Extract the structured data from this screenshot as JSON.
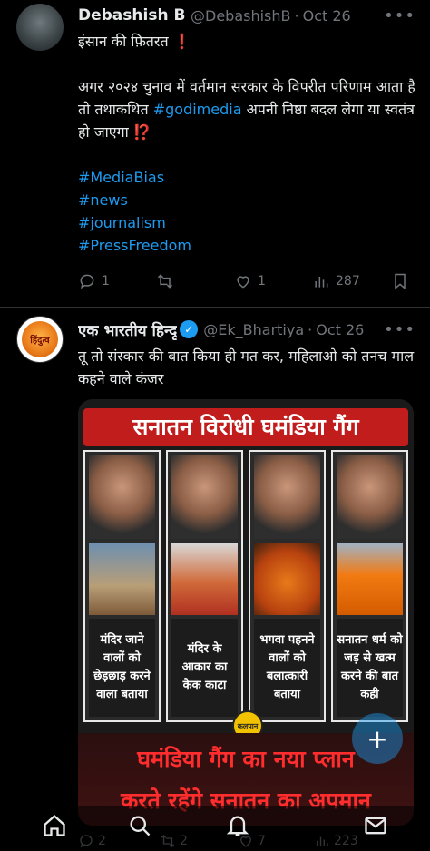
{
  "tweets": [
    {
      "name": "Debashish Bı",
      "handle": "@DebashishB",
      "time": "Oct 26",
      "line1": "इंसान की फ़ितरत",
      "line1_emoji": "❗",
      "para": "अगर २०२४ चुनाव में वर्तमान सरकार के विपरीत परिणाम आता है तो तथाकथित ",
      "para_link": "#godimedia",
      "para_end": " अपनी निष्ठा बदल लेगा या स्वतंत्र हो जाएगा ",
      "para_emoji": "⁉️",
      "hashtags": [
        "#MediaBias",
        "#news",
        "#journalism",
        "#PressFreedom"
      ],
      "replies": "1",
      "retweets": "",
      "likes": "1",
      "views": "287"
    },
    {
      "name": "एक भारतीय हिन्दू",
      "handle": "@Ek_Bhartiya",
      "time": "Oct 26",
      "text": "तू तो संस्कार की बात किया ही मत कर, महिलाओ को तनच माल कहने वाले कंजर",
      "logo_text": "हिंदुत्व",
      "replies": "2",
      "retweets": "2",
      "likes": "7",
      "views": "223"
    }
  ],
  "poster": {
    "title": "सनातन विरोधी घमंडिया गैंग",
    "captions": [
      "मंदिर जाने वालों को छेड़छाड़ करने वाला बताया",
      "मंदिर के आकार का केक काटा",
      "भगवा पहनने वालों को बलात्कारी बताया",
      "सनातन धर्म को जड़ से खत्म करने की बात कही"
    ],
    "badge": "कलपान",
    "banner_line1": "घमंडिया गैंग का नया प्लान",
    "banner_line2": "करते रहेंगे सनातन का अपमान"
  },
  "icons": {
    "reply": "reply-icon",
    "retweet": "retweet-icon",
    "like": "heart-icon",
    "views": "views-icon",
    "bookmark": "bookmark-icon",
    "more": "more-icon",
    "home": "home-icon",
    "search": "search-icon",
    "notifications": "bell-icon",
    "messages": "mail-icon",
    "compose": "compose-icon"
  },
  "colors": {
    "accent": "#1d9bf0",
    "background": "#000000",
    "muted": "#71767b",
    "poster_red": "#c21d1d"
  }
}
